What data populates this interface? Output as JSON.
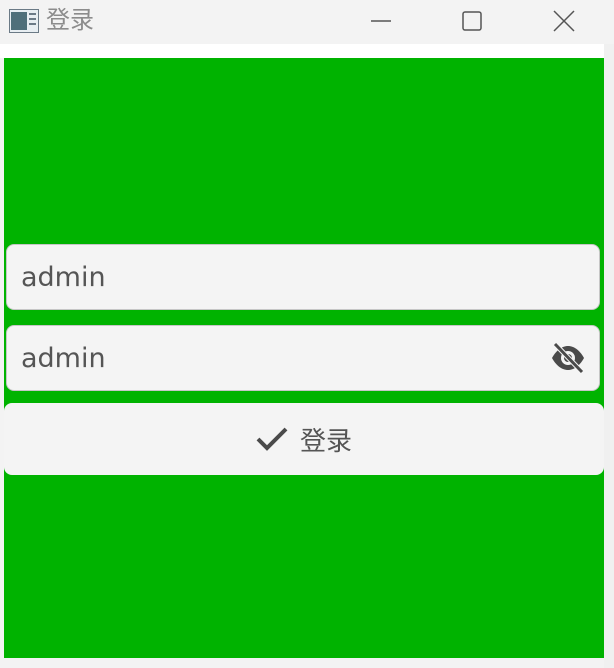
{
  "window": {
    "title": "登录"
  },
  "form": {
    "username_value": "admin",
    "password_value": "admin",
    "login_button_label": "登录"
  },
  "colors": {
    "content_background": "#00b300",
    "field_background": "#f4f4f4",
    "text": "#555555"
  },
  "icons": {
    "app": "app-window-icon",
    "minimize": "minimize-icon",
    "maximize": "maximize-icon",
    "close": "close-icon",
    "password_toggle": "eye-slash-icon",
    "login": "check-icon"
  }
}
